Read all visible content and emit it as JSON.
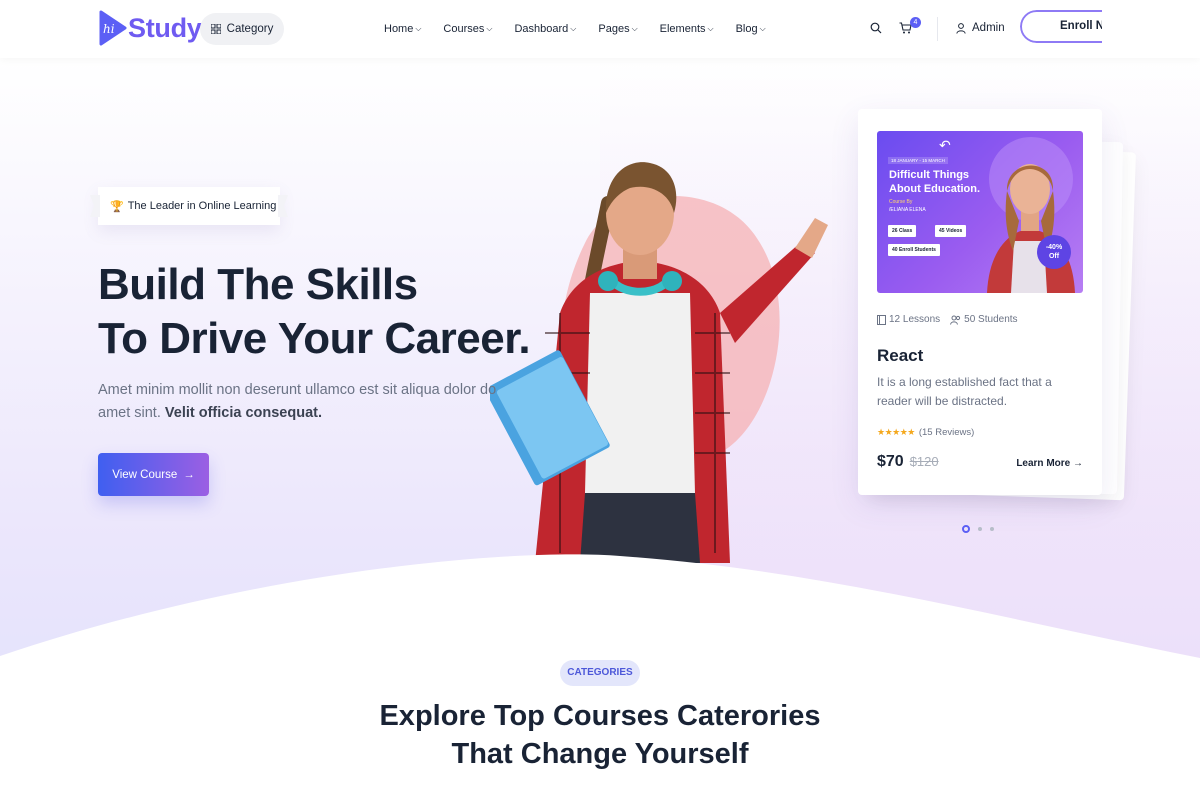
{
  "header": {
    "logo_text": "Study",
    "logo_mark_text": "hi",
    "category_label": "Category",
    "nav": [
      "Home",
      "Courses",
      "Dashboard",
      "Pages",
      "Elements",
      "Blog"
    ],
    "cart_count": "4",
    "admin_label": "Admin",
    "enroll_label": "Enroll Now"
  },
  "hero": {
    "badge": "The Leader in Online Learning",
    "title_line1": "Build The Skills",
    "title_line2": "To Drive Your Career.",
    "desc": "Amet minim mollit non deserunt ullamco est sit aliqua dolor do amet sint.",
    "desc_bold": "Velit officia consequat.",
    "cta": "View Course"
  },
  "course_card": {
    "thumb": {
      "date": "18 JANUARY - 15 MARCH",
      "title": "Difficult Things About Education.",
      "course_by": "Course By",
      "instructor": "/ELIANA ELENA",
      "chip_class": "26 Class",
      "chip_videos": "45 Videos",
      "chip_students": "40 Enroll Students",
      "discount": "-40%",
      "discount_sub": "Off"
    },
    "lessons": "12 Lessons",
    "students": "50 Students",
    "title": "React",
    "desc": "It is a long established fact that a reader will be distracted.",
    "reviews": "(15 Reviews)",
    "rating": 5,
    "price": "$70",
    "old_price": "$120",
    "learn_more": "Learn More"
  },
  "slider": {
    "count": 3,
    "active": 0
  },
  "categories": {
    "badge": "CATEGORIES",
    "title_line1": "Explore Top Courses Caterories",
    "title_line2": "That Change Yourself"
  },
  "colors": {
    "brand": "#6f5bf1",
    "accent": "#5c5ff5",
    "dark": "#192335",
    "muted": "#6b7385",
    "star": "#f4a81d"
  }
}
